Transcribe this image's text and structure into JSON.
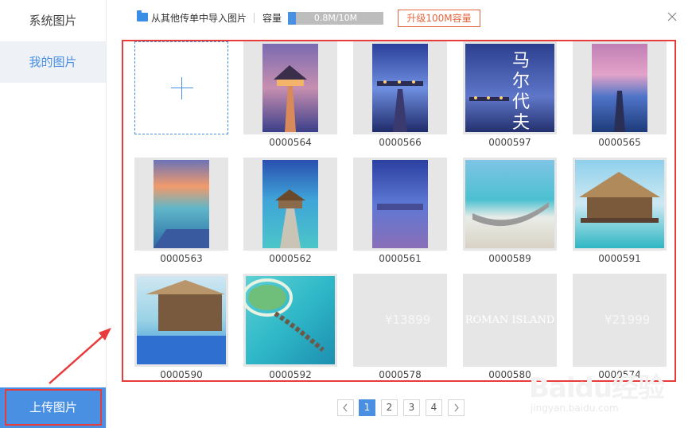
{
  "sidebar": {
    "items": [
      {
        "label": "系统图片"
      },
      {
        "label": "我的图片"
      }
    ],
    "upload_label": "上传图片"
  },
  "topbar": {
    "import_label": "从其他传单中导入图片",
    "capacity_label": "容量",
    "capacity_text": "0.8M/10M",
    "capacity_fraction": 0.08,
    "upgrade_label": "升级100M容量"
  },
  "images": [
    {
      "label": "0000564"
    },
    {
      "label": "0000566"
    },
    {
      "label": "0000597",
      "overlay_text": "马尔代夫"
    },
    {
      "label": "0000565"
    },
    {
      "label": "0000563"
    },
    {
      "label": "0000562"
    },
    {
      "label": "0000561"
    },
    {
      "label": "0000589"
    },
    {
      "label": "0000591"
    },
    {
      "label": "0000590"
    },
    {
      "label": "0000592"
    },
    {
      "label": "0000578",
      "overlay_text": "¥13899"
    },
    {
      "label": "0000580",
      "overlay_text": "ROMAN ISLAND"
    },
    {
      "label": "0000574",
      "overlay_text": "¥21999"
    }
  ],
  "pagination": {
    "pages": [
      "1",
      "2",
      "3",
      "4"
    ],
    "current": "1"
  },
  "watermark": {
    "name": "Baidu经验",
    "url": "jingyan.baidu.com"
  },
  "colors": {
    "accent": "#4a90e2",
    "highlight_red": "#e83c3c",
    "upgrade_orange": "#e6673c"
  }
}
